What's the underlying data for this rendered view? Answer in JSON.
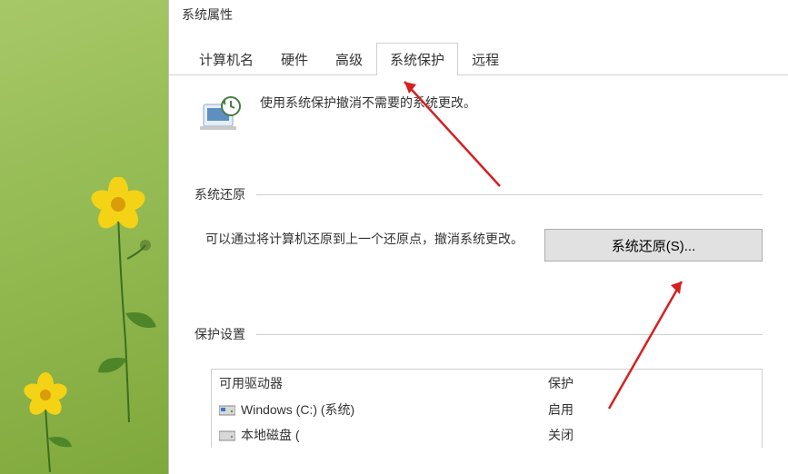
{
  "title": "系统属性",
  "tabs": {
    "computer_name": "计算机名",
    "hardware": "硬件",
    "advanced": "高级",
    "system_protection": "系统保护",
    "remote": "远程"
  },
  "intro_text": "使用系统保护撤消不需要的系统更改。",
  "section_restore": {
    "heading": "系统还原",
    "desc": "可以通过将计算机还原到上一个还原点，撤消系统更改。",
    "button": "系统还原(S)..."
  },
  "section_protect": {
    "heading": "保护设置"
  },
  "drive_table": {
    "col_drive": "可用驱动器",
    "col_protect": "保护",
    "rows": [
      {
        "name": "Windows (C:) (系统)",
        "status": "启用"
      },
      {
        "name": "本地磁盘 (",
        "status": "关闭"
      }
    ]
  },
  "icons": {
    "restore": "restore-icon",
    "drive_os": "os-drive-icon",
    "drive_local": "local-drive-icon"
  }
}
